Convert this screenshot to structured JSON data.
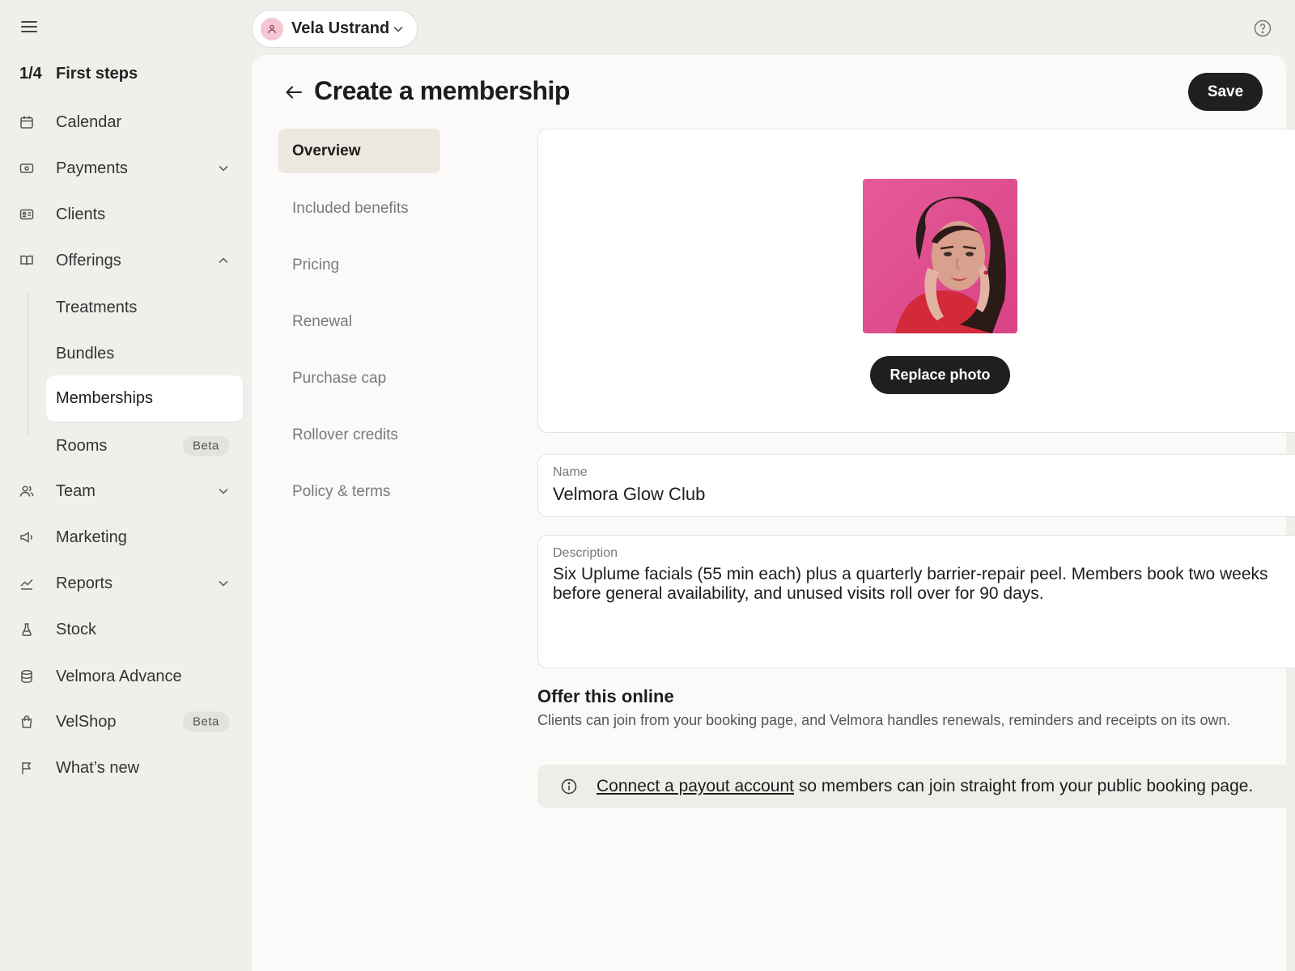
{
  "sidebar": {
    "first_steps": {
      "ratio": "1/4",
      "label": "First steps"
    },
    "items": {
      "calendar": "Calendar",
      "payments": "Payments",
      "clients": "Clients",
      "offerings": "Offerings",
      "treatments": "Treatments",
      "bundles": "Bundles",
      "memberships": "Memberships",
      "rooms": "Rooms",
      "team": "Team",
      "marketing": "Marketing",
      "reports": "Reports",
      "stock": "Stock",
      "velmora_advance": "Velmora Advance",
      "velshop": "VelShop",
      "whats_new": "What’s new"
    },
    "badges": {
      "rooms": "Beta",
      "velshop": "Beta"
    }
  },
  "header": {
    "user_name": "Vela Ustrand"
  },
  "page": {
    "title": "Create a membership",
    "save_label": "Save"
  },
  "sections": {
    "overview": "Overview",
    "included_benefits": "Included benefits",
    "pricing": "Pricing",
    "renewal": "Renewal",
    "purchase_cap": "Purchase cap",
    "rollover_credits": "Rollover credits",
    "policy_terms": "Policy & terms"
  },
  "photo": {
    "replace_label": "Replace photo"
  },
  "form": {
    "name_label": "Name",
    "name_value": "Velmora Glow Club",
    "description_label": "Description",
    "description_value": "Six Uplume facials (55 min each) plus a quarterly barrier-repair peel. Members book two weeks before general availability, and unused visits roll over for 90 days."
  },
  "offer": {
    "title": "Offer this online",
    "text": "Clients can join from your booking page, and Velmora handles renewals, reminders and receipts on its own."
  },
  "notice": {
    "link": "Connect a payout account",
    "text": " so members can join straight from your public booking page."
  },
  "colors": {
    "accent_dark": "#1f1f1f",
    "active_tab": "#ece7df",
    "photo_bg": "#e0508f"
  }
}
